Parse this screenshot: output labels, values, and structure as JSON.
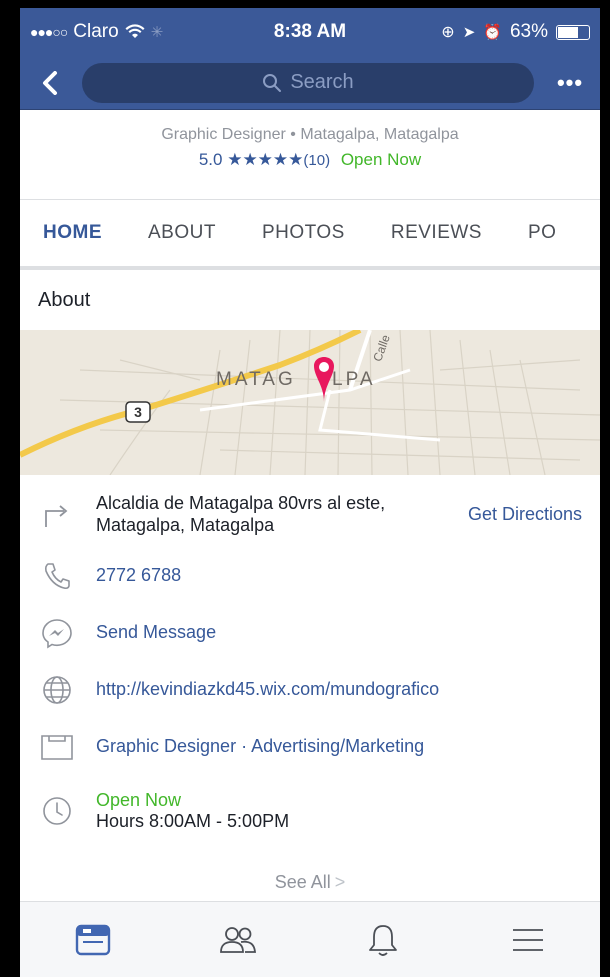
{
  "status_bar": {
    "carrier": "Claro",
    "time": "8:38 AM",
    "battery": "63%",
    "battery_level": 0.63
  },
  "nav": {
    "search_placeholder": "Search",
    "more_label": "•••"
  },
  "page": {
    "subtitle": "Graphic Designer • Matagalpa, Matagalpa",
    "rating": "5.0",
    "stars": "★★★★★",
    "review_count": "(10)",
    "open_status": "Open Now"
  },
  "tabs": [
    {
      "label": "HOME",
      "active": true
    },
    {
      "label": "ABOUT"
    },
    {
      "label": "PHOTOS"
    },
    {
      "label": "REVIEWS"
    },
    {
      "label": "PO"
    }
  ],
  "about": {
    "title": "About",
    "map": {
      "city_label_left": "MATAG",
      "city_label_right": "LPA",
      "street_label": "Calle",
      "route_number": "3"
    },
    "address": "Alcaldia de Matagalpa 80vrs al este, Matagalpa, Matagalpa",
    "get_directions": "Get Directions",
    "phone": "2772 6788",
    "message": "Send Message",
    "website": "http://kevindiazkd45.wix.com/mundografico",
    "category": "Graphic Designer · Advertising/Marketing",
    "hours_status": "Open Now",
    "hours": "Hours 8:00AM - 5:00PM",
    "see_all": "See All",
    "see_all_chevron": ">"
  },
  "colors": {
    "brand": "#3b5998",
    "link": "#365899",
    "open_green": "#42b72a",
    "pin": "#e8175d"
  }
}
